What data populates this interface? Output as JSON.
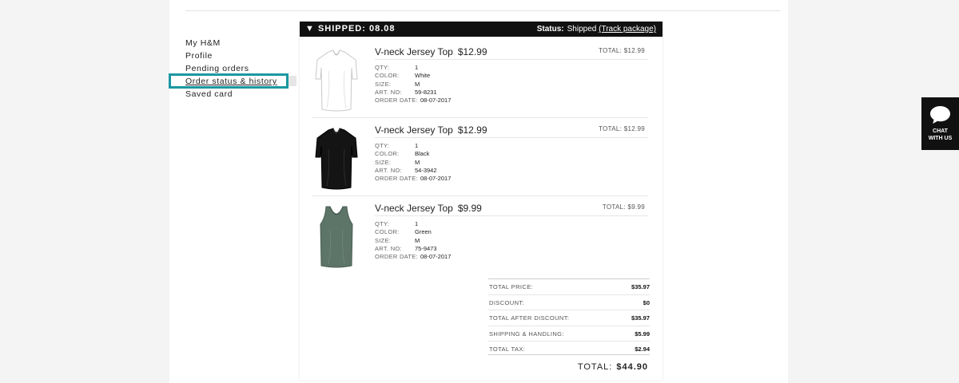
{
  "sidebar": {
    "items": [
      {
        "label": "My H&M"
      },
      {
        "label": "Profile"
      },
      {
        "label": "Pending orders"
      },
      {
        "label": "Order status & history"
      },
      {
        "label": "Saved card"
      }
    ],
    "active_index": 3
  },
  "order": {
    "header_title": "▼ SHIPPED: 08.08",
    "status_label": "Status:",
    "status_value": "Shipped",
    "track_link": "(Track package)",
    "items": [
      {
        "name": "V-neck Jersey Top",
        "price": "$12.99",
        "total_label": "TOTAL:",
        "total_value": "$12.99",
        "qty": "1",
        "color": "White",
        "size": "M",
        "art_no": "59-8231",
        "order_date": "08-07-2017",
        "color_hex": "#ffffff"
      },
      {
        "name": "V-neck Jersey Top",
        "price": "$12.99",
        "total_label": "TOTAL:",
        "total_value": "$12.99",
        "qty": "1",
        "color": "Black",
        "size": "M",
        "art_no": "54-3942",
        "order_date": "08-07-2017",
        "color_hex": "#141414"
      },
      {
        "name": "V-neck Jersey Top",
        "price": "$9.99",
        "total_label": "TOTAL:",
        "total_value": "$9.99",
        "qty": "1",
        "color": "Green",
        "size": "M",
        "art_no": "75-9473",
        "order_date": "08-07-2017",
        "color_hex": "#5d7468"
      }
    ],
    "attr_labels": {
      "qty": "QTY:",
      "color": "COLOR:",
      "size": "SIZE:",
      "art_no": "ART. NO:",
      "order_date": "ORDER DATE:"
    },
    "summary": [
      {
        "label": "TOTAL PRICE:",
        "value": "$35.97"
      },
      {
        "label": "DISCOUNT:",
        "value": "$0"
      },
      {
        "label": "TOTAL AFTER DISCOUNT:",
        "value": "$35.97"
      },
      {
        "label": "SHIPPING & HANDLING:",
        "value": "$5.99"
      },
      {
        "label": "TOTAL TAX:",
        "value": "$2.94"
      }
    ],
    "grand_total_label": "TOTAL:",
    "grand_total_value": "$44.90"
  },
  "chat": {
    "line1": "CHAT",
    "line2": "WITH US",
    "icon": "speech-bubble-icon"
  },
  "colors": {
    "highlight": "#1b97a2",
    "header_bg": "#111111"
  }
}
